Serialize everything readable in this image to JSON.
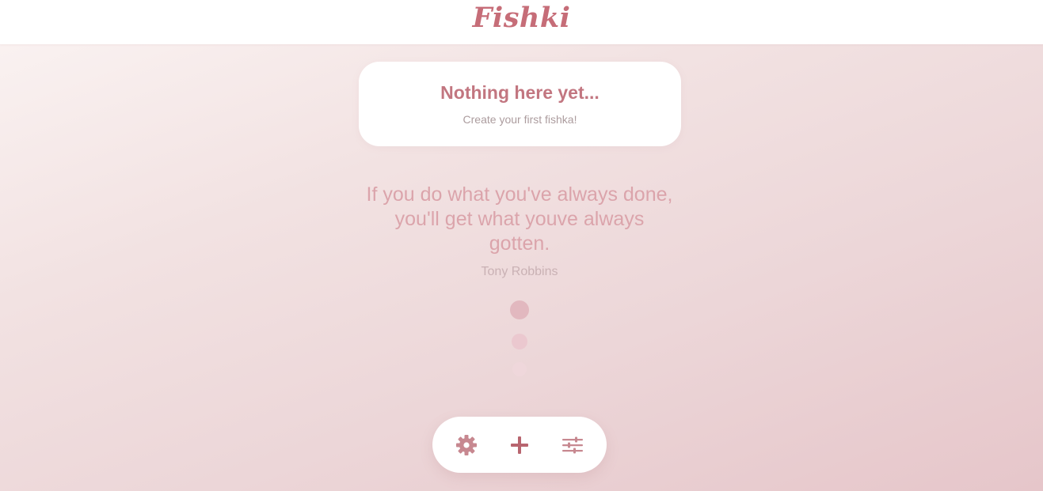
{
  "header": {
    "logo_text": "Fishki"
  },
  "empty_state": {
    "title": "Nothing here yet...",
    "subtitle": "Create your first fishka!"
  },
  "quote": {
    "text": "If you do what you've always done, you'll get what youve always gotten.",
    "author": "Tony Robbins"
  },
  "toolbar": {
    "buttons": [
      {
        "icon": "gear-icon",
        "action": "settings"
      },
      {
        "icon": "plus-icon",
        "action": "add"
      },
      {
        "icon": "sliders-icon",
        "action": "filter"
      }
    ]
  },
  "colors": {
    "accent": "#c66d78",
    "quote_text": "#dba4ab",
    "background_start": "#fbf4f3",
    "background_end": "#e6c6ca",
    "card": "#ffffff"
  }
}
